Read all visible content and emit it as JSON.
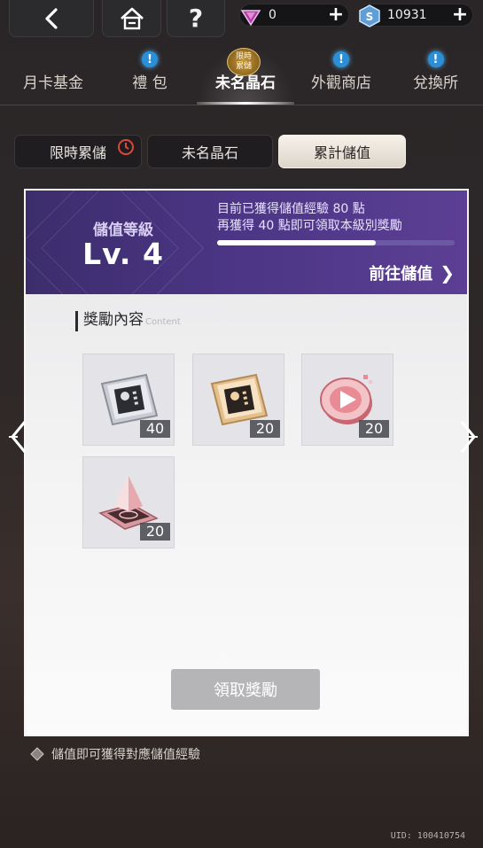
{
  "topbar": {
    "currency1_value": "0",
    "currency2_value": "10931",
    "help_label": "?"
  },
  "main_tabs": [
    {
      "label": "月卡基金",
      "badge": false
    },
    {
      "label": "禮 包",
      "badge": true
    },
    {
      "label": "未名晶石",
      "badge": false,
      "active": true,
      "tag_line1": "限時",
      "tag_line2": "累儲"
    },
    {
      "label": "外觀商店",
      "badge": true
    },
    {
      "label": "兌換所",
      "badge": true
    }
  ],
  "badge_glyph": "!",
  "sub_tabs": [
    {
      "label": "限時累儲"
    },
    {
      "label": "未名晶石"
    },
    {
      "label": "累計儲值",
      "active": true
    }
  ],
  "banner": {
    "level_label": "儲值等級",
    "level_value": "Lv. 4",
    "exp_line1": "目前已獲得儲值經驗 80 點",
    "exp_line2": "再獲得 40 點即可領取本級別獎勵",
    "progress": 0.667,
    "goto_label": "前往儲值",
    "goto_arrow": "❯"
  },
  "rewards": {
    "title": "獎勵內容",
    "subtitle": "Content",
    "items": [
      {
        "icon": "silver-chip-icon",
        "count": "40"
      },
      {
        "icon": "gold-chip-icon",
        "count": "20"
      },
      {
        "icon": "pink-play-token-icon",
        "count": "20"
      },
      {
        "icon": "pink-pyramid-icon",
        "count": "20"
      }
    ]
  },
  "claim_button": "領取獎勵",
  "note": "儲值即可獲得對應儲值經驗",
  "uid": "UID: 100410754",
  "colors": {
    "banner": "#4b3584",
    "badge": "#2b8fd8",
    "claim_disabled": "#b5b5b8"
  }
}
